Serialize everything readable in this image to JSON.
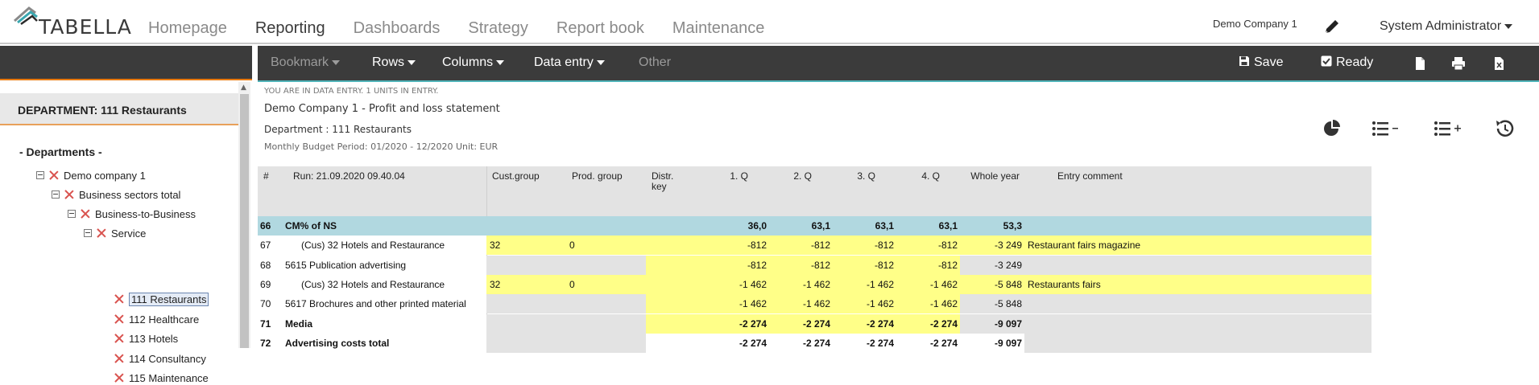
{
  "app": {
    "logo_text": "TABELLA",
    "nav": [
      "Homepage",
      "Reporting",
      "Dashboards",
      "Strategy",
      "Report book",
      "Maintenance"
    ],
    "active_nav": "Reporting",
    "company": "Demo Company 1",
    "user": "System Administrator"
  },
  "toolbar": {
    "bookmark": "Bookmark",
    "rows": "Rows",
    "columns": "Columns",
    "data_entry": "Data entry",
    "other": "Other",
    "save": "Save",
    "ready": "Ready"
  },
  "left": {
    "department_title": "DEPARTMENT: 111 Restaurants",
    "tree_header": "- Departments -",
    "tree": [
      {
        "label": "Demo company 1",
        "level": 0,
        "expandable": true
      },
      {
        "label": "Business sectors total",
        "level": 1,
        "expandable": true
      },
      {
        "label": "Business-to-Business",
        "level": 2,
        "expandable": true
      },
      {
        "label": "Service",
        "level": 3,
        "expandable": true
      },
      {
        "label": "111 Restaurants",
        "level": 4,
        "expandable": false,
        "selected": true
      },
      {
        "label": "112 Healthcare",
        "level": 4,
        "expandable": false
      },
      {
        "label": "113 Hotels",
        "level": 4,
        "expandable": false
      },
      {
        "label": "114 Consultancy",
        "level": 4,
        "expandable": false
      },
      {
        "label": "115 Maintenance",
        "level": 4,
        "expandable": false
      }
    ]
  },
  "info": {
    "status": "YOU ARE IN DATA ENTRY. 1 UNITS IN ENTRY.",
    "title": "Demo Company 1 - Profit and loss statement",
    "department": "Department : 111 Restaurants",
    "period": "Monthly Budget Period: 01/2020 - 12/2020 Unit: EUR"
  },
  "colors": {
    "toolbar_bg": "#3b3b3b",
    "accent_orange": "#e8790f",
    "accent_teal": "#4fb3b8",
    "row_blue": "#b1d8e0",
    "entry_yellow": "#ffff88",
    "grey_cell": "#e3e3e3"
  },
  "table": {
    "headers": {
      "num": "#",
      "run": "Run: 21.09.2020 09.40.04",
      "cust": "Cust.group",
      "prod": "Prod. group",
      "distr": "Distr. key",
      "q1": "1. Q",
      "q2": "2. Q",
      "q3": "3. Q",
      "q4": "4. Q",
      "whole": "Whole year",
      "comment": "Entry comment"
    },
    "rows": [
      {
        "num": "66",
        "label": "CM% of NS",
        "cust": "",
        "prod": "",
        "q1": "36,0",
        "q2": "63,1",
        "q3": "63,1",
        "q4": "63,1",
        "whole": "53,3",
        "comment": "",
        "style": "highlight"
      },
      {
        "num": "67",
        "label": "(Cus) 32 Hotels and Restaurance",
        "cust": "32",
        "prod": "0",
        "q1": "-812",
        "q2": "-812",
        "q3": "-812",
        "q4": "-812",
        "whole": "-3 249",
        "comment": "Restaurant fairs magazine",
        "style": "entry",
        "indent": true
      },
      {
        "num": "68",
        "label": "5615 Publication advertising",
        "cust": "",
        "prod": "",
        "q1": "-812",
        "q2": "-812",
        "q3": "-812",
        "q4": "-812",
        "whole": "-3 249",
        "comment": "",
        "style": "account"
      },
      {
        "num": "69",
        "label": "(Cus) 32 Hotels and Restaurance",
        "cust": "32",
        "prod": "0",
        "q1": "-1 462",
        "q2": "-1 462",
        "q3": "-1 462",
        "q4": "-1 462",
        "whole": "-5 848",
        "comment": "Restaurants fairs",
        "style": "entry",
        "indent": true
      },
      {
        "num": "70",
        "label": "5617 Brochures and other printed material",
        "cust": "",
        "prod": "",
        "q1": "-1 462",
        "q2": "-1 462",
        "q3": "-1 462",
        "q4": "-1 462",
        "whole": "-5 848",
        "comment": "",
        "style": "account"
      },
      {
        "num": "71",
        "label": "Media",
        "cust": "",
        "prod": "",
        "q1": "-2 274",
        "q2": "-2 274",
        "q3": "-2 274",
        "q4": "-2 274",
        "whole": "-9 097",
        "comment": "",
        "style": "subtotal"
      },
      {
        "num": "72",
        "label": "Advertising costs total",
        "cust": "",
        "prod": "",
        "q1": "-2 274",
        "q2": "-2 274",
        "q3": "-2 274",
        "q4": "-2 274",
        "whole": "-9 097",
        "comment": "",
        "style": "total"
      }
    ]
  }
}
